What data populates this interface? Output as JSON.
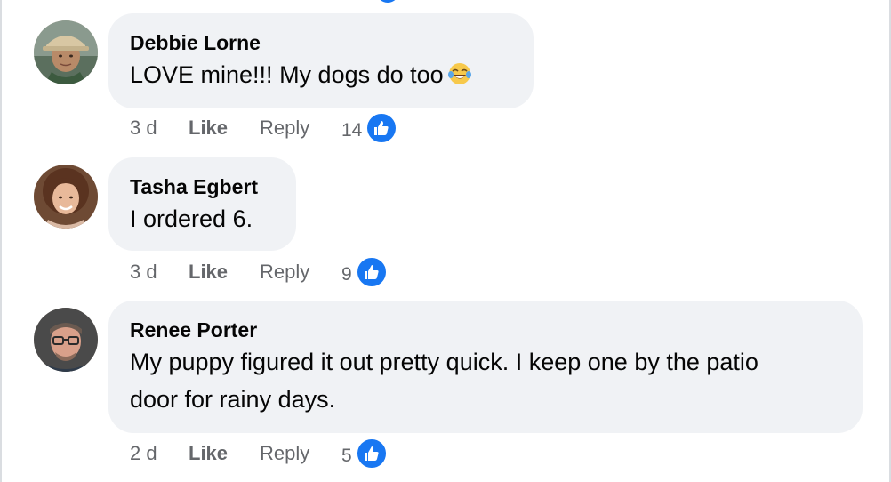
{
  "comments": [
    {
      "author": "Debbie Lorne",
      "text": "LOVE mine!!! My dogs do too",
      "emoji": "tears-of-joy-emoji",
      "time": "3 d",
      "like_label": "Like",
      "reply_label": "Reply",
      "like_count": "14"
    },
    {
      "author": "Tasha Egbert",
      "text": "I ordered 6.",
      "time": "3 d",
      "like_label": "Like",
      "reply_label": "Reply",
      "like_count": "9"
    },
    {
      "author": "Renee Porter",
      "text_line1": "My puppy figured it out pretty quick. I keep one by the patio",
      "text_line2": "door for rainy days.",
      "time": "2 d",
      "like_label": "Like",
      "reply_label": "Reply",
      "like_count": "5"
    }
  ],
  "colors": {
    "bubble": "#f0f2f5",
    "like_blue": "#1877f2",
    "meta_gray": "#65676b",
    "text": "#050505"
  },
  "icons": {
    "reaction": "thumbs-up-icon"
  }
}
